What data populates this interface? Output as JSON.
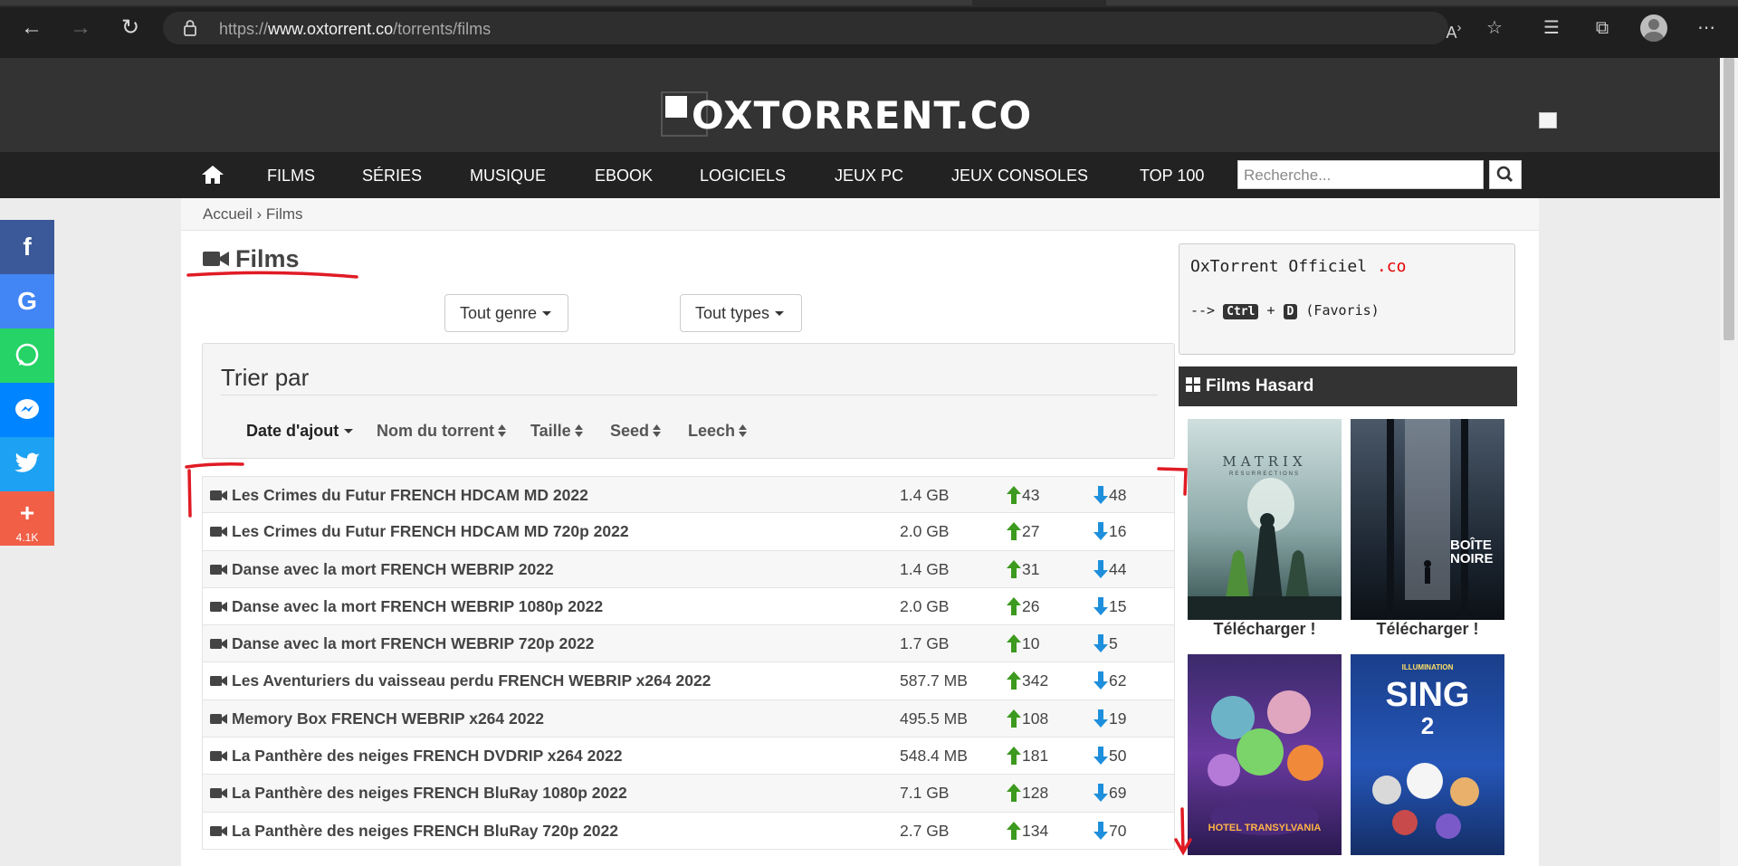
{
  "browser": {
    "url_prefix": "https://",
    "url_domain": "www.oxtorrent.co",
    "url_path": "/torrents/films"
  },
  "site": {
    "logo_text": "OXTORRENT.CO",
    "nav": [
      "FILMS",
      "SÉRIES",
      "MUSIQUE",
      "EBOOK",
      "LOGICIELS",
      "JEUX PC",
      "JEUX CONSOLES",
      "TOP 100"
    ],
    "search_placeholder": "Recherche..."
  },
  "breadcrumb": "Accueil › Films",
  "page_title": "Films",
  "filters": {
    "genre": "Tout genre",
    "types": "Tout types"
  },
  "sort": {
    "title": "Trier par",
    "options": [
      "Date d'ajout",
      "Nom du torrent",
      "Taille",
      "Seed",
      "Leech"
    ]
  },
  "torrents": [
    {
      "name": "Les Crimes du Futur FRENCH HDCAM MD 2022",
      "size": "1.4 GB",
      "seed": "43",
      "leech": "48"
    },
    {
      "name": "Les Crimes du Futur FRENCH HDCAM MD 720p 2022",
      "size": "2.0 GB",
      "seed": "27",
      "leech": "16"
    },
    {
      "name": "Danse avec la mort FRENCH WEBRIP 2022",
      "size": "1.4 GB",
      "seed": "31",
      "leech": "44"
    },
    {
      "name": "Danse avec la mort FRENCH WEBRIP 1080p 2022",
      "size": "2.0 GB",
      "seed": "26",
      "leech": "15"
    },
    {
      "name": "Danse avec la mort FRENCH WEBRIP 720p 2022",
      "size": "1.7 GB",
      "seed": "10",
      "leech": "5"
    },
    {
      "name": "Les Aventuriers du vaisseau perdu FRENCH WEBRIP x264 2022",
      "size": "587.7 MB",
      "seed": "342",
      "leech": "62"
    },
    {
      "name": "Memory Box FRENCH WEBRIP x264 2022",
      "size": "495.5 MB",
      "seed": "108",
      "leech": "19"
    },
    {
      "name": "La Panthère des neiges FRENCH DVDRIP x264 2022",
      "size": "548.4 MB",
      "seed": "181",
      "leech": "50"
    },
    {
      "name": "La Panthère des neiges FRENCH BluRay 1080p 2022",
      "size": "7.1 GB",
      "seed": "128",
      "leech": "69"
    },
    {
      "name": "La Panthère des neiges FRENCH BluRay 720p 2022",
      "size": "2.7 GB",
      "seed": "134",
      "leech": "70"
    }
  ],
  "sidebar": {
    "official_title": "OxTorrent Officiel ",
    "official_tld": ".co",
    "shortcut_prefix": "-->",
    "key_ctrl": "Ctrl",
    "key_plus": "+",
    "key_d": "D",
    "shortcut_suffix": "(Favoris)",
    "hasard_title": "Films Hasard",
    "poster_matrix_title": "MATRIX",
    "poster_matrix_sub": "RESURRECTIONS",
    "poster_boite_title": "BOÎTE NOIRE",
    "poster_sing_brand": "ILLUMINATION",
    "poster_sing_title": "SING",
    "poster_sing_num": "2",
    "poster_hotel_title": "HOTEL TRANSYLVANIA",
    "download_label": "Télécharger !"
  },
  "social": {
    "icons": [
      "facebook-icon",
      "google-icon",
      "whatsapp-icon",
      "messenger-icon",
      "twitter-icon",
      "share-plus-icon"
    ],
    "colors": [
      "#3b5998",
      "#4285f4",
      "#25d366",
      "#0084ff",
      "#1da1f2",
      "#f05f46"
    ],
    "share_count": "4.1K"
  }
}
